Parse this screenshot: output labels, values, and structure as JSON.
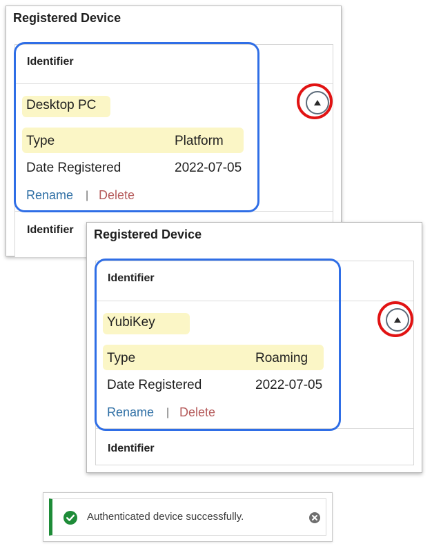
{
  "panels": [
    {
      "title": "Registered Device",
      "header": "Identifier",
      "device_name": "Desktop PC",
      "type_label": "Type",
      "type_value": "Platform",
      "date_label": "Date Registered",
      "date_value": "2022-07-05",
      "rename_label": "Rename",
      "separator": "|",
      "delete_label": "Delete",
      "next_header": "Identifier"
    },
    {
      "title": "Registered Device",
      "header": "Identifier",
      "device_name": "YubiKey",
      "type_label": "Type",
      "type_value": "Roaming",
      "date_label": "Date Registered",
      "date_value": "2022-07-05",
      "rename_label": "Rename",
      "separator": "|",
      "delete_label": "Delete",
      "next_header": "Identifier"
    }
  ],
  "toast": {
    "message": "Authenticated device successfully.",
    "status_icon": "check-circle-icon",
    "dismiss_icon": "close-circle-icon"
  },
  "colors": {
    "highlight": "#fbf6c6",
    "annotation_blue": "#2f6ee6",
    "annotation_red": "#e11313",
    "link": "#2f6fa5",
    "danger": "#b55a5a",
    "success": "#1e8c38"
  }
}
